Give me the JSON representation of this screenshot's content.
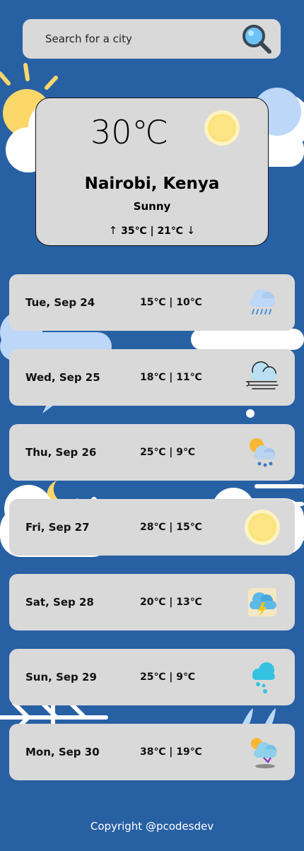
{
  "search": {
    "placeholder": "Search for a city",
    "icon": "search-icon"
  },
  "current": {
    "temperature": "30℃",
    "city": "Nairobi, Kenya",
    "condition": "Sunny",
    "high": "35℃",
    "low": "21℃",
    "separator": "|",
    "up_arrow": "↑",
    "down_arrow": "↓",
    "icon": "sun-icon"
  },
  "forecast": [
    {
      "date": "Tue, Sep 24",
      "temps": "15℃ | 10℃",
      "icon": "rain-cloud-icon"
    },
    {
      "date": "Wed, Sep 25",
      "temps": "18℃ | 11℃",
      "icon": "windy-cloud-icon"
    },
    {
      "date": "Thu, Sep 26",
      "temps": "25℃ | 9℃",
      "icon": "sun-rain-cloud-icon"
    },
    {
      "date": "Fri, Sep 27",
      "temps": "28℃ | 15℃",
      "icon": "sun-icon"
    },
    {
      "date": "Sat, Sep 28",
      "temps": "20℃ | 13℃",
      "icon": "thunderstorm-icon"
    },
    {
      "date": "Sun, Sep 29",
      "temps": "25℃ | 9℃",
      "icon": "drizzle-cloud-icon"
    },
    {
      "date": "Mon, Sep 30",
      "temps": "38℃ | 19℃",
      "icon": "sun-cloud-icon"
    }
  ],
  "footer": {
    "text": "Copyright @pcodesdev"
  },
  "colors": {
    "background": "#2860a4",
    "card": "#d9d9d9",
    "sun": "#fbe37a",
    "cloud_light": "#bcd7f7"
  }
}
